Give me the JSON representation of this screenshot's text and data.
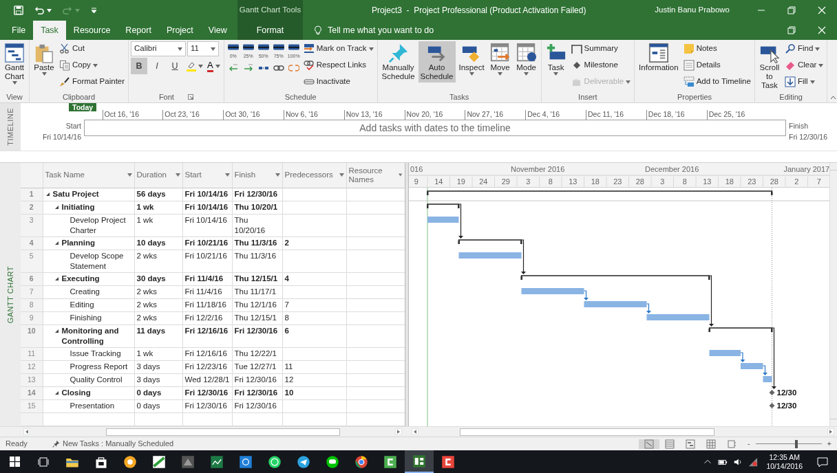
{
  "title_bar": {
    "context_label": "Gantt Chart Tools",
    "title": "Project3  -  Project Professional (Product Activation Failed)",
    "user": "Justin Banu Prabowo"
  },
  "tabs": [
    {
      "label": "File",
      "selected": false,
      "contextual": false
    },
    {
      "label": "Task",
      "selected": true,
      "contextual": false
    },
    {
      "label": "Resource",
      "selected": false,
      "contextual": false
    },
    {
      "label": "Report",
      "selected": false,
      "contextual": false
    },
    {
      "label": "Project",
      "selected": false,
      "contextual": false
    },
    {
      "label": "View",
      "selected": false,
      "contextual": false
    },
    {
      "label": "Format",
      "selected": false,
      "contextual": true
    }
  ],
  "tell_me": {
    "placeholder": "Tell me what you want to do"
  },
  "ribbon": [
    {
      "label": "View",
      "columns": [
        [
          [
            {
              "kind": "large",
              "label": "Gantt Chart",
              "dropdown": true
            }
          ]
        ]
      ]
    },
    {
      "label": "Clipboard",
      "columns": [
        [
          [
            {
              "kind": "large",
              "label": "Paste",
              "dropdown": true
            }
          ]
        ],
        [
          [
            {
              "kind": "small",
              "label": "Cut"
            }
          ],
          [
            {
              "kind": "small",
              "label": "Copy",
              "dropdown": true
            }
          ],
          [
            {
              "kind": "small",
              "label": "Format Painter"
            }
          ]
        ]
      ]
    },
    {
      "label": "Font",
      "launcher": true,
      "columns": [
        [
          [
            {
              "kind": "combo",
              "value": "Calibri"
            },
            {
              "kind": "combo",
              "value": "11"
            }
          ],
          [
            {
              "kind": "format",
              "label": "B",
              "on": true
            },
            {
              "kind": "format",
              "label": "I",
              "on": false
            },
            {
              "kind": "format",
              "label": "U",
              "on": false
            },
            {
              "kind": "icon",
              "dropdown": true
            },
            {
              "kind": "fontcolor",
              "label": "A",
              "dropdown": true
            }
          ]
        ]
      ]
    },
    {
      "label": "Schedule",
      "columns": [
        [
          [
            {
              "kind": "percent",
              "label": "0%"
            },
            {
              "kind": "percent",
              "label": "25%"
            },
            {
              "kind": "percent",
              "label": "50%"
            },
            {
              "kind": "percent",
              "label": "75%"
            },
            {
              "kind": "percent",
              "label": "100%"
            }
          ],
          [
            {
              "kind": "icon"
            },
            {
              "kind": "icon"
            },
            {
              "kind": "icon"
            },
            {
              "kind": "icon"
            },
            {
              "kind": "icon"
            }
          ]
        ],
        [
          [
            {
              "kind": "small",
              "label": "Mark on Track",
              "dropdown": true
            }
          ],
          [
            {
              "kind": "small",
              "label": "Respect Links"
            }
          ],
          [
            {
              "kind": "small",
              "label": "Inactivate"
            }
          ]
        ]
      ]
    },
    {
      "label": "Tasks",
      "columns": [
        [
          [
            {
              "kind": "large",
              "label": "Manually Schedule",
              "selected": false
            }
          ]
        ],
        [
          [
            {
              "kind": "large",
              "label": "Auto Schedule",
              "selected": true
            }
          ]
        ],
        [
          [
            {
              "kind": "large",
              "label": "Inspect",
              "dropdown": true
            }
          ]
        ],
        [
          [
            {
              "kind": "large",
              "label": "Move",
              "dropdown": true
            }
          ]
        ],
        [
          [
            {
              "kind": "large",
              "label": "Mode",
              "dropdown": true
            }
          ]
        ]
      ]
    },
    {
      "label": "Insert",
      "columns": [
        [
          [
            {
              "kind": "large",
              "label": "Task",
              "dropdown": true
            }
          ]
        ],
        [
          [
            {
              "kind": "small",
              "label": "Summary",
              "disabled": false
            }
          ],
          [
            {
              "kind": "small",
              "label": "Milestone",
              "disabled": false
            }
          ],
          [
            {
              "kind": "small",
              "label": "Deliverable",
              "disabled": true,
              "dropdown": true
            }
          ]
        ]
      ]
    },
    {
      "label": "Properties",
      "columns": [
        [
          [
            {
              "kind": "large",
              "label": "Information"
            }
          ]
        ],
        [
          [
            {
              "kind": "small",
              "label": "Notes"
            }
          ],
          [
            {
              "kind": "small",
              "label": "Details"
            }
          ],
          [
            {
              "kind": "small",
              "label": "Add to Timeline"
            }
          ]
        ]
      ]
    },
    {
      "label": "Editing",
      "columns": [
        [
          [
            {
              "kind": "large",
              "label": "Scroll to Task"
            }
          ]
        ],
        [
          [
            {
              "kind": "small",
              "label": "Find",
              "dropdown": true
            }
          ],
          [
            {
              "kind": "small",
              "label": "Clear",
              "dropdown": true
            }
          ],
          [
            {
              "kind": "small",
              "label": "Fill",
              "dropdown": true
            }
          ]
        ]
      ]
    }
  ],
  "timeline": {
    "side_label": "TIMELINE",
    "today": "Today",
    "start_label": "Start",
    "start_date": "Fri 10/14/16",
    "finish_label": "Finish",
    "finish_date": "Fri 12/30/16",
    "hint": "Add tasks with dates to the timeline",
    "dates": [
      "Oct 16, '16",
      "Oct 23, '16",
      "Oct 30, '16",
      "Nov 6, '16",
      "Nov 13, '16",
      "Nov 20, '16",
      "Nov 27, '16",
      "Dec 4, '16",
      "Dec 11, '16",
      "Dec 18, '16",
      "Dec 25, '16"
    ]
  },
  "view": {
    "side_label": "GANTT CHART"
  },
  "table": {
    "columns": [
      "Task Name",
      "Duration",
      "Start",
      "Finish",
      "Predecessors",
      "Resource Names"
    ],
    "rows": [
      {
        "id": "1",
        "name": "Satu Project",
        "duration": "56 days",
        "start": "Fri 10/14/16",
        "finish": "Fri 12/30/16",
        "expanded": true,
        "children": [
          {
            "id": "2",
            "name": "Initiating",
            "duration": "1 wk",
            "start": "Fri 10/14/16",
            "finish": "Thu 10/20/1",
            "expanded": true,
            "children": [
              {
                "id": "3",
                "name": "Develop Project Charter",
                "duration": "1 wk",
                "start": "Fri 10/14/16",
                "finish": "Thu 10/20/16"
              }
            ]
          },
          {
            "id": "4",
            "name": "Planning",
            "duration": "10 days",
            "start": "Fri 10/21/16",
            "finish": "Thu 11/3/16",
            "predecessors": "2",
            "expanded": true,
            "children": [
              {
                "id": "5",
                "name": "Develop Scope Statement",
                "duration": "2 wks",
                "start": "Fri 10/21/16",
                "finish": "Thu 11/3/16"
              }
            ]
          },
          {
            "id": "6",
            "name": "Executing",
            "duration": "30 days",
            "start": "Fri 11/4/16",
            "finish": "Thu 12/15/1",
            "predecessors": "4",
            "expanded": true,
            "children": [
              {
                "id": "7",
                "name": "Creating",
                "duration": "2 wks",
                "start": "Fri 11/4/16",
                "finish": "Thu 11/17/1"
              },
              {
                "id": "8",
                "name": "Editing",
                "duration": "2 wks",
                "start": "Fri 11/18/16",
                "finish": "Thu 12/1/16",
                "predecessors": "7"
              },
              {
                "id": "9",
                "name": "Finishing",
                "duration": "2 wks",
                "start": "Fri 12/2/16",
                "finish": "Thu 12/15/1",
                "predecessors": "8"
              }
            ]
          },
          {
            "id": "10",
            "name": "Monitoring and Controlling",
            "duration": "11 days",
            "start": "Fri 12/16/16",
            "finish": "Fri 12/30/16",
            "predecessors": "6",
            "expanded": true,
            "children": [
              {
                "id": "11",
                "name": "Issue Tracking",
                "duration": "1 wk",
                "start": "Fri 12/16/16",
                "finish": "Thu 12/22/1"
              },
              {
                "id": "12",
                "name": "Progress Report",
                "duration": "3 days",
                "start": "Fri 12/23/16",
                "finish": "Tue 12/27/1",
                "predecessors": "11"
              },
              {
                "id": "13",
                "name": "Quality Control",
                "duration": "3 days",
                "start": "Wed 12/28/1",
                "finish": "Fri 12/30/16",
                "predecessors": "12"
              }
            ]
          },
          {
            "id": "14",
            "name": "Closing",
            "duration": "0 days",
            "start": "Fri 12/30/16",
            "finish": "Fri 12/30/16",
            "predecessors": "10",
            "bar_label": "12/30",
            "expanded": true,
            "children": [
              {
                "id": "15",
                "name": "Presentation",
                "duration": "0 days",
                "start": "Fri 12/30/16",
                "finish": "Fri 12/30/16",
                "bar_label": "12/30"
              }
            ]
          }
        ]
      }
    ]
  },
  "gantt": {
    "months": [
      "016",
      "November 2016",
      "December 2016",
      "January 2017"
    ],
    "days": [
      "9",
      "14",
      "19",
      "24",
      "29",
      "3",
      "8",
      "13",
      "18",
      "23",
      "28",
      "3",
      "8",
      "13",
      "18",
      "23",
      "28",
      "2",
      "7"
    ]
  },
  "status_bar": {
    "ready": "Ready",
    "new_tasks": "New Tasks : Manually Scheduled",
    "zoom_out": "-",
    "zoom_in": "+",
    "zoom": {
      "level": 0.62
    }
  },
  "taskbar": {
    "time": "12:35 AM",
    "date": "10/14/2016"
  }
}
